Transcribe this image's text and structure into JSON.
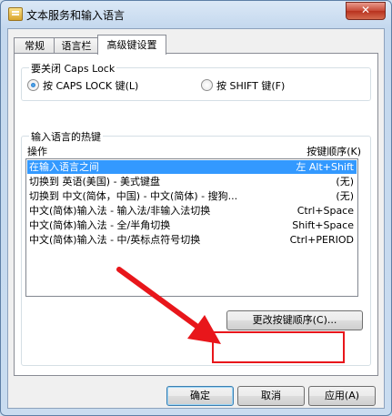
{
  "window": {
    "title": "文本服务和输入语言",
    "close_glyph": "✕"
  },
  "tabs": [
    {
      "label": "常规"
    },
    {
      "label": "语言栏"
    },
    {
      "label": "高级键设置"
    }
  ],
  "caps_lock": {
    "legend": "要关闭 Caps Lock",
    "option1": "按 CAPS LOCK 键(L)",
    "option2": "按 SHIFT 键(F)",
    "selected": "option1"
  },
  "hotkeys": {
    "legend": "输入语言的热键",
    "col_action": "操作",
    "col_key": "按键顺序(K)",
    "rows": [
      {
        "action": "在输入语言之间",
        "key": "左 Alt+Shift",
        "selected": true
      },
      {
        "action": "切换到 英语(美国) - 美式键盘",
        "key": "(无)"
      },
      {
        "action": "切换到 中文(简体，中国) - 中文(简体) - 搜狗...",
        "key": "(无)"
      },
      {
        "action": "中文(简体)输入法 - 输入法/非输入法切换",
        "key": "Ctrl+Space"
      },
      {
        "action": "中文(简体)输入法 - 全/半角切换",
        "key": "Shift+Space"
      },
      {
        "action": "中文(简体)输入法 - 中/英标点符号切换",
        "key": "Ctrl+PERIOD"
      }
    ],
    "change_button": "更改按键顺序(C)..."
  },
  "buttons": {
    "ok": "确定",
    "cancel": "取消",
    "apply": "应用(A)"
  },
  "colors": {
    "annotation_red": "#e8161b",
    "selection_blue": "#3399ff"
  }
}
